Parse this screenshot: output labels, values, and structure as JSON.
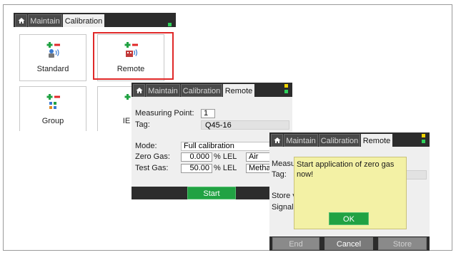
{
  "screen1": {
    "tabs": [
      "Maintain",
      "Calibration"
    ],
    "tiles": [
      {
        "label": "Standard",
        "icon": "calibration-standard-icon"
      },
      {
        "label": "Remote",
        "icon": "calibration-remote-icon"
      },
      {
        "label": "Group",
        "icon": "calibration-group-icon"
      },
      {
        "label": "IE",
        "icon": "calibration-ie-icon"
      }
    ],
    "highlight_color": "#e02828"
  },
  "screen2": {
    "tabs": [
      "Maintain",
      "Calibration",
      "Remote"
    ],
    "measuring_point_label": "Measuring Point:",
    "measuring_point_value": "1",
    "tag_label": "Tag:",
    "tag_value": "Q45-16",
    "mode_label": "Mode:",
    "mode_value": "Full calibration",
    "zero_gas_label": "Zero Gas:",
    "zero_gas_value": "0.000",
    "zero_gas_unit": "% LEL",
    "zero_gas_type": "Air",
    "test_gas_label": "Test Gas:",
    "test_gas_value": "50.00",
    "test_gas_unit": "% LEL",
    "test_gas_type": "Metha",
    "start_label": "Start"
  },
  "screen3": {
    "tabs": [
      "Maintain",
      "Calibration",
      "Remote"
    ],
    "partial_measuring": "Measu",
    "partial_tag": "Tag:",
    "partial_store": "Store v",
    "partial_signal": "Signal",
    "dialog_message": "Start application of zero gas now!",
    "ok_label": "OK",
    "end_label": "End",
    "cancel_label": "Cancel",
    "store_label": "Store"
  },
  "colors": {
    "accent_green": "#21a243",
    "dark_bar": "#2c2c2c",
    "dialog_bg": "#f3f1a5"
  }
}
